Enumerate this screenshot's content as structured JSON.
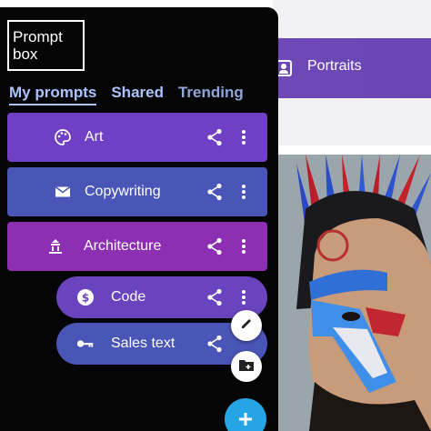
{
  "app": {
    "logo_text": "Prompt\nbox"
  },
  "tabs": [
    {
      "label": "My prompts",
      "active": true
    },
    {
      "label": "Shared",
      "active": false
    },
    {
      "label": "Trending",
      "active": false
    }
  ],
  "prompts": [
    {
      "label": "Art",
      "icon": "palette-icon",
      "color": "#6f40c4"
    },
    {
      "label": "Copywriting",
      "icon": "envelope-icon",
      "color": "#4a55b8"
    },
    {
      "label": "Architecture",
      "icon": "building-icon",
      "color": "#8c2fb2"
    }
  ],
  "sub_prompts": [
    {
      "label": "Code",
      "icon": "dollar-coin-icon",
      "color": "#6a44bf"
    },
    {
      "label": "Sales text",
      "icon": "key-icon",
      "color": "#4a55b8"
    }
  ],
  "detail": {
    "title": "Portraits",
    "icon": "portrait-icon"
  },
  "actions": {
    "edit_icon": "pencil-icon",
    "new_folder_icon": "folder-plus-icon",
    "add_icon": "plus-icon",
    "add_color": "#25a5e3"
  }
}
